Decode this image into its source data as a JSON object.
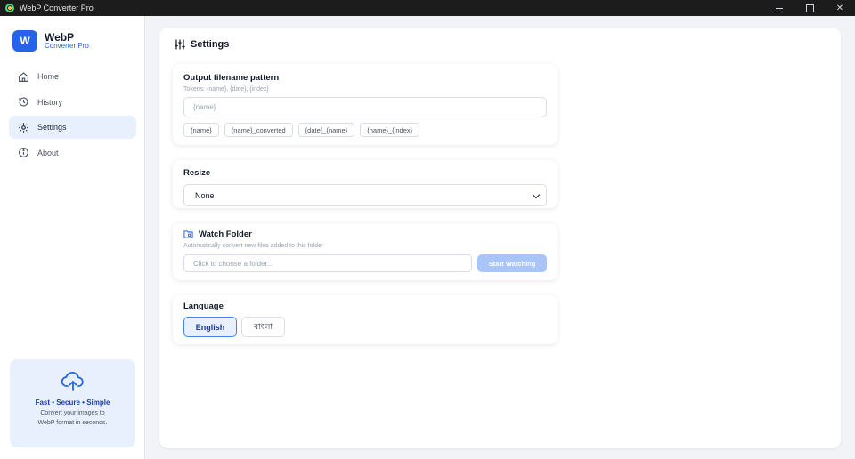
{
  "window": {
    "title": "WebP Converter Pro"
  },
  "brand": {
    "logo_letter": "W",
    "name": "WebP",
    "subtitle": "Converter Pro",
    "color": "#2563eb"
  },
  "sidebar": {
    "items": [
      {
        "label": "Home",
        "icon": "home-icon"
      },
      {
        "label": "History",
        "icon": "history-icon"
      },
      {
        "label": "Settings",
        "icon": "gear-icon",
        "active": true
      },
      {
        "label": "About",
        "icon": "info-icon"
      }
    ],
    "promo": {
      "icon": "cloud-upload-icon",
      "title": "Fast • Secure • Simple",
      "desc": "Convert your images to WebP format in seconds."
    }
  },
  "page": {
    "title": "Settings",
    "icon": "sliders-icon"
  },
  "output_pattern": {
    "title": "Output filename pattern",
    "tokens_hint": "Tokens: {name}, {date}, {index}",
    "placeholder": "{name}",
    "value": "",
    "chips": [
      "{name}",
      "{name}_converted",
      "{date}_{name}",
      "{name}_{index}"
    ]
  },
  "resize": {
    "title": "Resize",
    "selected": "None"
  },
  "watch_folder": {
    "title": "Watch Folder",
    "icon": "folder-icon",
    "description": "Automatically convert new files added to this folder",
    "placeholder": "Click to choose a folder...",
    "button": "Start Watching"
  },
  "language": {
    "title": "Language",
    "options": [
      {
        "label": "English",
        "selected": true
      },
      {
        "label": "বাংলা",
        "selected": false
      }
    ]
  }
}
